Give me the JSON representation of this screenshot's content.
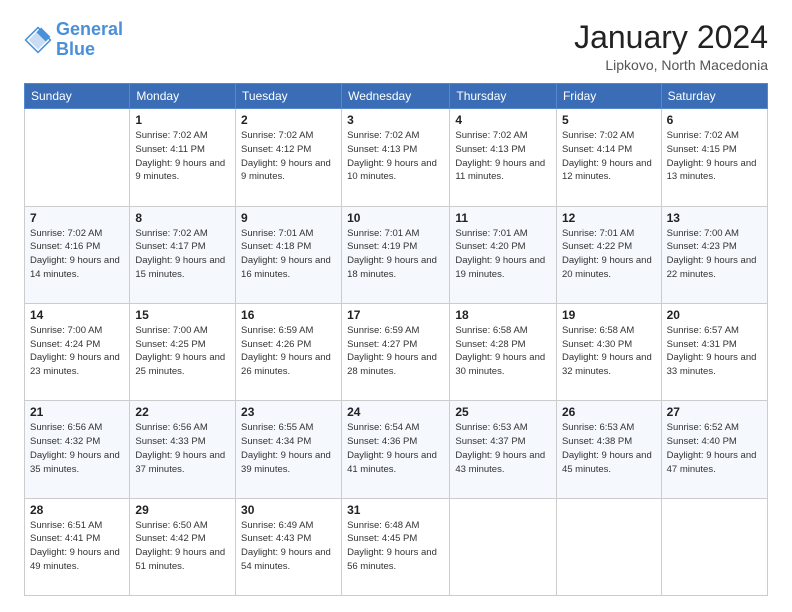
{
  "logo": {
    "line1": "General",
    "line2": "Blue"
  },
  "title": "January 2024",
  "subtitle": "Lipkovo, North Macedonia",
  "days_of_week": [
    "Sunday",
    "Monday",
    "Tuesday",
    "Wednesday",
    "Thursday",
    "Friday",
    "Saturday"
  ],
  "weeks": [
    [
      {
        "day": "",
        "sunrise": "",
        "sunset": "",
        "daylight": ""
      },
      {
        "day": "1",
        "sunrise": "7:02 AM",
        "sunset": "4:11 PM",
        "daylight": "9 hours and 9 minutes."
      },
      {
        "day": "2",
        "sunrise": "7:02 AM",
        "sunset": "4:12 PM",
        "daylight": "9 hours and 9 minutes."
      },
      {
        "day": "3",
        "sunrise": "7:02 AM",
        "sunset": "4:13 PM",
        "daylight": "9 hours and 10 minutes."
      },
      {
        "day": "4",
        "sunrise": "7:02 AM",
        "sunset": "4:13 PM",
        "daylight": "9 hours and 11 minutes."
      },
      {
        "day": "5",
        "sunrise": "7:02 AM",
        "sunset": "4:14 PM",
        "daylight": "9 hours and 12 minutes."
      },
      {
        "day": "6",
        "sunrise": "7:02 AM",
        "sunset": "4:15 PM",
        "daylight": "9 hours and 13 minutes."
      }
    ],
    [
      {
        "day": "7",
        "sunrise": "7:02 AM",
        "sunset": "4:16 PM",
        "daylight": "9 hours and 14 minutes."
      },
      {
        "day": "8",
        "sunrise": "7:02 AM",
        "sunset": "4:17 PM",
        "daylight": "9 hours and 15 minutes."
      },
      {
        "day": "9",
        "sunrise": "7:01 AM",
        "sunset": "4:18 PM",
        "daylight": "9 hours and 16 minutes."
      },
      {
        "day": "10",
        "sunrise": "7:01 AM",
        "sunset": "4:19 PM",
        "daylight": "9 hours and 18 minutes."
      },
      {
        "day": "11",
        "sunrise": "7:01 AM",
        "sunset": "4:20 PM",
        "daylight": "9 hours and 19 minutes."
      },
      {
        "day": "12",
        "sunrise": "7:01 AM",
        "sunset": "4:22 PM",
        "daylight": "9 hours and 20 minutes."
      },
      {
        "day": "13",
        "sunrise": "7:00 AM",
        "sunset": "4:23 PM",
        "daylight": "9 hours and 22 minutes."
      }
    ],
    [
      {
        "day": "14",
        "sunrise": "7:00 AM",
        "sunset": "4:24 PM",
        "daylight": "9 hours and 23 minutes."
      },
      {
        "day": "15",
        "sunrise": "7:00 AM",
        "sunset": "4:25 PM",
        "daylight": "9 hours and 25 minutes."
      },
      {
        "day": "16",
        "sunrise": "6:59 AM",
        "sunset": "4:26 PM",
        "daylight": "9 hours and 26 minutes."
      },
      {
        "day": "17",
        "sunrise": "6:59 AM",
        "sunset": "4:27 PM",
        "daylight": "9 hours and 28 minutes."
      },
      {
        "day": "18",
        "sunrise": "6:58 AM",
        "sunset": "4:28 PM",
        "daylight": "9 hours and 30 minutes."
      },
      {
        "day": "19",
        "sunrise": "6:58 AM",
        "sunset": "4:30 PM",
        "daylight": "9 hours and 32 minutes."
      },
      {
        "day": "20",
        "sunrise": "6:57 AM",
        "sunset": "4:31 PM",
        "daylight": "9 hours and 33 minutes."
      }
    ],
    [
      {
        "day": "21",
        "sunrise": "6:56 AM",
        "sunset": "4:32 PM",
        "daylight": "9 hours and 35 minutes."
      },
      {
        "day": "22",
        "sunrise": "6:56 AM",
        "sunset": "4:33 PM",
        "daylight": "9 hours and 37 minutes."
      },
      {
        "day": "23",
        "sunrise": "6:55 AM",
        "sunset": "4:34 PM",
        "daylight": "9 hours and 39 minutes."
      },
      {
        "day": "24",
        "sunrise": "6:54 AM",
        "sunset": "4:36 PM",
        "daylight": "9 hours and 41 minutes."
      },
      {
        "day": "25",
        "sunrise": "6:53 AM",
        "sunset": "4:37 PM",
        "daylight": "9 hours and 43 minutes."
      },
      {
        "day": "26",
        "sunrise": "6:53 AM",
        "sunset": "4:38 PM",
        "daylight": "9 hours and 45 minutes."
      },
      {
        "day": "27",
        "sunrise": "6:52 AM",
        "sunset": "4:40 PM",
        "daylight": "9 hours and 47 minutes."
      }
    ],
    [
      {
        "day": "28",
        "sunrise": "6:51 AM",
        "sunset": "4:41 PM",
        "daylight": "9 hours and 49 minutes."
      },
      {
        "day": "29",
        "sunrise": "6:50 AM",
        "sunset": "4:42 PM",
        "daylight": "9 hours and 51 minutes."
      },
      {
        "day": "30",
        "sunrise": "6:49 AM",
        "sunset": "4:43 PM",
        "daylight": "9 hours and 54 minutes."
      },
      {
        "day": "31",
        "sunrise": "6:48 AM",
        "sunset": "4:45 PM",
        "daylight": "9 hours and 56 minutes."
      },
      {
        "day": "",
        "sunrise": "",
        "sunset": "",
        "daylight": ""
      },
      {
        "day": "",
        "sunrise": "",
        "sunset": "",
        "daylight": ""
      },
      {
        "day": "",
        "sunrise": "",
        "sunset": "",
        "daylight": ""
      }
    ]
  ]
}
